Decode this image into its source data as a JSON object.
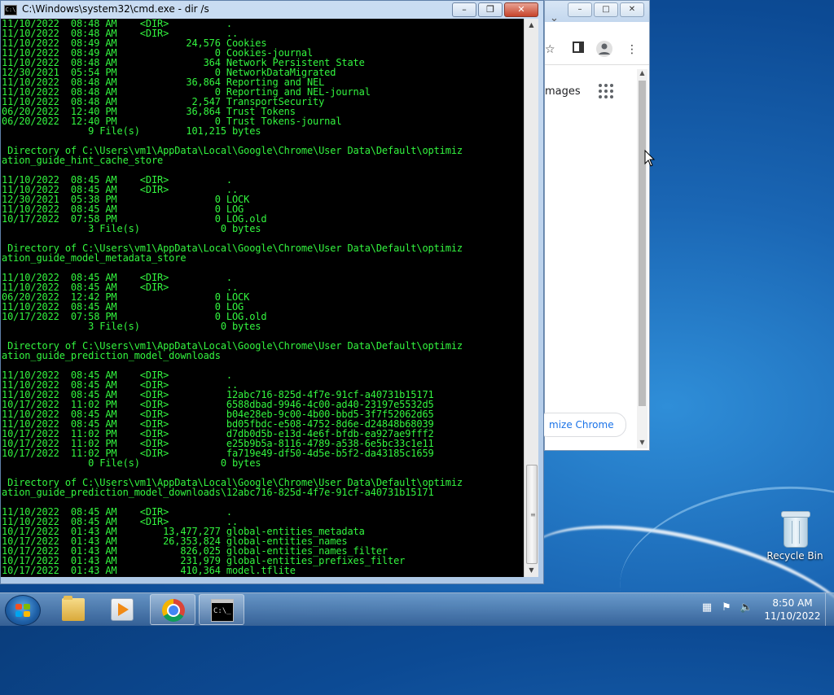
{
  "desktop": {
    "recycle_bin_label": "Recycle Bin"
  },
  "chrome_window": {
    "images_link": "mages",
    "customize_button": "mize Chrome"
  },
  "cmd_window": {
    "title": "C:\\Windows\\system32\\cmd.exe - dir /s",
    "app_icon_text": "C:\\",
    "console_lines": [
      "11/10/2022  08:48 AM    <DIR>          .",
      "11/10/2022  08:48 AM    <DIR>          ..",
      "11/10/2022  08:49 AM            24,576 Cookies",
      "11/10/2022  08:49 AM                 0 Cookies-journal",
      "11/10/2022  08:48 AM               364 Network Persistent State",
      "12/30/2021  05:54 PM                 0 NetworkDataMigrated",
      "11/10/2022  08:48 AM            36,864 Reporting and NEL",
      "11/10/2022  08:48 AM                 0 Reporting and NEL-journal",
      "11/10/2022  08:48 AM             2,547 TransportSecurity",
      "06/20/2022  12:40 PM            36,864 Trust Tokens",
      "06/20/2022  12:40 PM                 0 Trust Tokens-journal",
      "               9 File(s)        101,215 bytes",
      "",
      " Directory of C:\\Users\\vm1\\AppData\\Local\\Google\\Chrome\\User Data\\Default\\optimiz",
      "ation_guide_hint_cache_store",
      "",
      "11/10/2022  08:45 AM    <DIR>          .",
      "11/10/2022  08:45 AM    <DIR>          ..",
      "12/30/2021  05:38 PM                 0 LOCK",
      "11/10/2022  08:45 AM                 0 LOG",
      "10/17/2022  07:58 PM                 0 LOG.old",
      "               3 File(s)              0 bytes",
      "",
      " Directory of C:\\Users\\vm1\\AppData\\Local\\Google\\Chrome\\User Data\\Default\\optimiz",
      "ation_guide_model_metadata_store",
      "",
      "11/10/2022  08:45 AM    <DIR>          .",
      "11/10/2022  08:45 AM    <DIR>          ..",
      "06/20/2022  12:42 PM                 0 LOCK",
      "11/10/2022  08:45 AM                 0 LOG",
      "10/17/2022  07:58 PM                 0 LOG.old",
      "               3 File(s)              0 bytes",
      "",
      " Directory of C:\\Users\\vm1\\AppData\\Local\\Google\\Chrome\\User Data\\Default\\optimiz",
      "ation_guide_prediction_model_downloads",
      "",
      "11/10/2022  08:45 AM    <DIR>          .",
      "11/10/2022  08:45 AM    <DIR>          ..",
      "11/10/2022  08:45 AM    <DIR>          12abc716-825d-4f7e-91cf-a40731b15171",
      "10/17/2022  11:02 PM    <DIR>          6588dbad-9946-4c00-ad40-23197e5532d5",
      "11/10/2022  08:45 AM    <DIR>          b04e28eb-9c00-4b00-bbd5-3f7f52062d65",
      "11/10/2022  08:45 AM    <DIR>          bd05fbdc-e508-4752-8d6e-d24848b68039",
      "10/17/2022  11:02 PM    <DIR>          d7db0d5b-e13d-4e6f-bfdb-ea927ae9fff2",
      "10/17/2022  11:02 PM    <DIR>          e25b9b5a-8116-4789-a538-6e5bc33c1e11",
      "10/17/2022  11:02 PM    <DIR>          fa719e49-df50-4d5e-b5f2-da43185c1659",
      "               0 File(s)              0 bytes",
      "",
      " Directory of C:\\Users\\vm1\\AppData\\Local\\Google\\Chrome\\User Data\\Default\\optimiz",
      "ation_guide_prediction_model_downloads\\12abc716-825d-4f7e-91cf-a40731b15171",
      "",
      "11/10/2022  08:45 AM    <DIR>          .",
      "11/10/2022  08:45 AM    <DIR>          ..",
      "10/17/2022  01:43 AM        13,477,277 global-entities_metadata",
      "10/17/2022  01:43 AM        26,353,824 global-entities_names",
      "10/17/2022  01:43 AM           826,025 global-entities_names_filter",
      "10/17/2022  01:43 AM           231,979 global-entities_prefixes_filter",
      "10/17/2022  01:43 AM           410,364 model.tflite"
    ]
  },
  "taskbar": {
    "cmd_icon_text": "C:\\_",
    "clock_time": "8:50 AM",
    "clock_date": "11/10/2022"
  },
  "colors": {
    "console_text": "#33f53f",
    "console_bg": "#000000",
    "desktop_bg": "#1a66b4"
  }
}
